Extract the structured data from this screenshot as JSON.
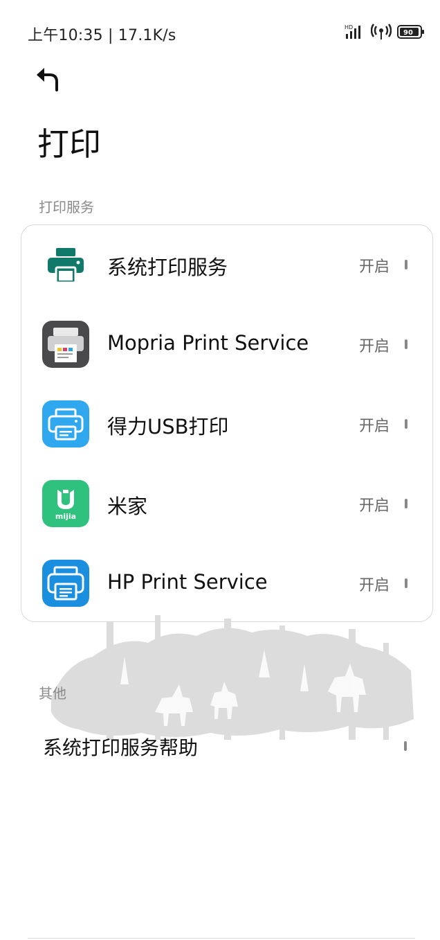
{
  "status_bar": {
    "time_speed": "上午10:35 | 17.1K/s",
    "signal_label": "HD",
    "battery_level": "90"
  },
  "header": {
    "back_icon": "back-arrow-icon",
    "title": "打印"
  },
  "sections": {
    "print_services_label": "打印服务",
    "other_label": "其他"
  },
  "services": [
    {
      "name": "系统打印服务",
      "status": "开启",
      "icon": "system-printer-icon"
    },
    {
      "name": "Mopria Print Service",
      "status": "开启",
      "icon": "mopria-icon"
    },
    {
      "name": "得力USB打印",
      "status": "开启",
      "icon": "deli-usb-printer-icon"
    },
    {
      "name": "米家",
      "status": "开启",
      "icon": "mijia-icon"
    },
    {
      "name": "HP Print Service",
      "status": "开启",
      "icon": "hp-print-icon"
    }
  ],
  "mijia_icon_text": "mijia",
  "other": {
    "help_label": "系统打印服务帮助"
  },
  "colors": {
    "system_print_teal": "#0f7a6a",
    "mopria_dark": "#4a4a4c",
    "deli_blue": "#2fa8f0",
    "mijia_green": "#2ec27e",
    "hp_blue": "#1a8fe0"
  }
}
